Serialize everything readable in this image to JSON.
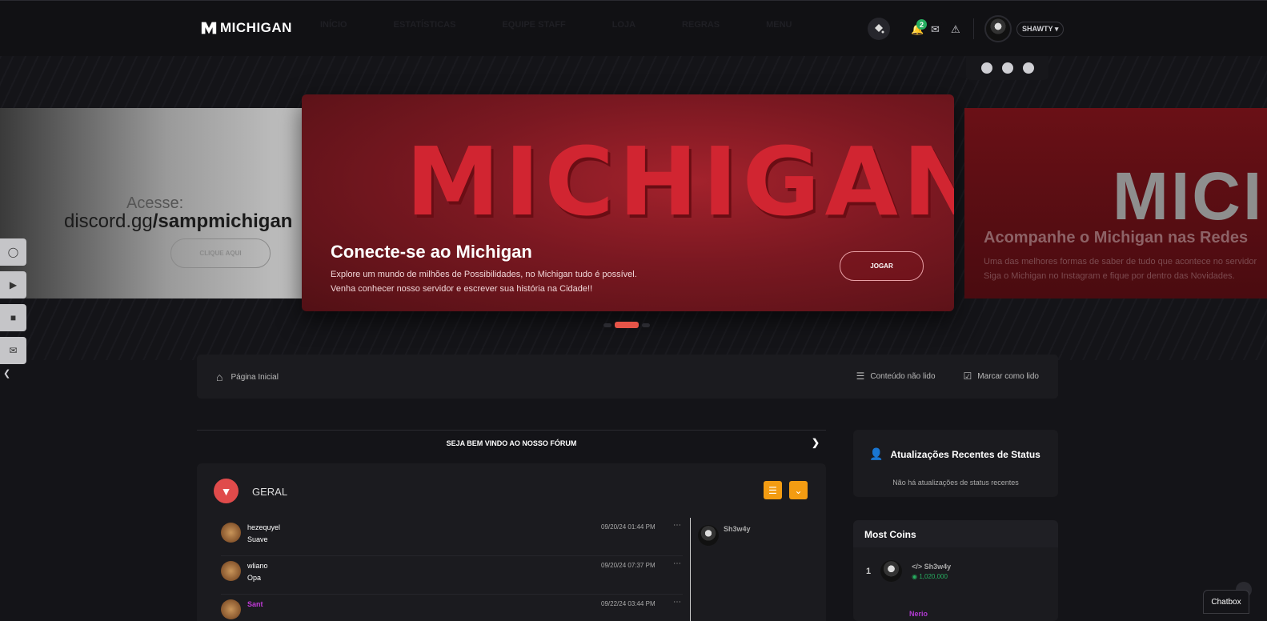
{
  "nav": {
    "brand": "MICHIGAN",
    "links": [
      "INÍCIO",
      "ESTATÍSTICAS",
      "EQUIPE STAFF",
      "LOJA",
      "REGRAS",
      "MENU"
    ],
    "notif_count": "2",
    "username": "SHAWTY ▾"
  },
  "slides": {
    "left": {
      "top": "Acesse:",
      "discord_plain": "discord.gg",
      "discord_bold": "/sampmichigan",
      "cta": "CLIQUE AQUI"
    },
    "main": {
      "brand": "MICHIGAN",
      "title": "Conecte-se ao Michigan",
      "line1": "Explore um mundo de milhões de Possibilidades, no Michigan tudo é possível.",
      "line2": "Venha conhecer nosso servidor e escrever sua história na Cidade!!",
      "cta": "JOGAR"
    },
    "right": {
      "brand": "MICI",
      "title": "Acompanhe o Michigan nas Redes",
      "line1": "Uma das melhores formas de saber de tudo que acontece no servidor",
      "line2": "Siga o Michigan no Instagram e fique por dentro das Novidades."
    }
  },
  "breadcrumb": {
    "home": "Página Inicial",
    "unread": "Conteúdo não lido",
    "mark_read": "Marcar como lido"
  },
  "welcome": "SEJA BEM VINDO AO NOSSO FÓRUM",
  "forum": {
    "category": "GERAL",
    "posts": [
      {
        "name": "hezequyel",
        "msg": "Suave",
        "date": "09/20/24 01:44 PM"
      },
      {
        "name": "wliano",
        "msg": "Opa",
        "date": "09/20/24 07:37 PM"
      },
      {
        "name": "Sant",
        "msg": "",
        "date": "09/22/24 03:44 PM"
      }
    ],
    "online_user": "Sh3w4y"
  },
  "status_widget": {
    "title": "Atualizações Recentes de Status",
    "empty": "Não há atualizações de status recentes"
  },
  "coins_widget": {
    "title": "Most Coins",
    "rank1": {
      "rank": "1",
      "name": "</> Sh3w4y",
      "amount": "1,020,000"
    },
    "rank2_name": "Nerio"
  },
  "chatbox": "Chatbox",
  "colors": {
    "accent_red": "#e04b4b",
    "accent_orange": "#f39c12",
    "green": "#27ae60"
  }
}
